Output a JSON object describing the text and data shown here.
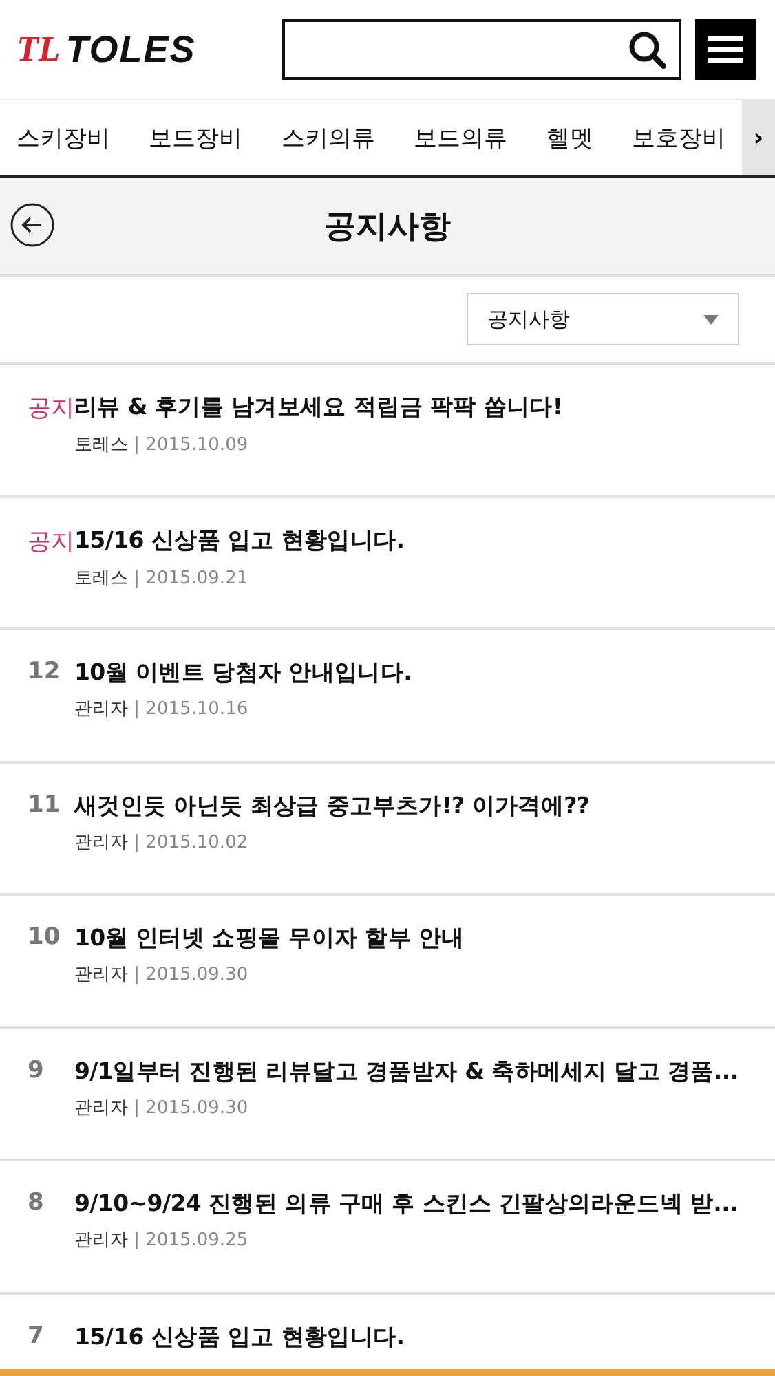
{
  "header": {
    "logo_mark": "TL",
    "logo_text": "TOLES"
  },
  "meta_separator": "|",
  "nav": {
    "items": [
      "스키장비",
      "보드장비",
      "스키의류",
      "보드의류",
      "헬멧",
      "보호장비"
    ],
    "more": "›"
  },
  "page_title": "공지사항",
  "filter": {
    "value": "공지사항"
  },
  "posts": [
    {
      "kind": "notice",
      "badge": "공지",
      "title": "리뷰 & 후기를 남겨보세요 적립금 팍팍 쏩니다!",
      "author": "토레스",
      "date": "2015.10.09"
    },
    {
      "kind": "notice",
      "badge": "공지",
      "title": "15/16 신상품 입고 현황입니다.",
      "author": "토레스",
      "date": "2015.09.21"
    },
    {
      "kind": "numbered",
      "badge": "12",
      "title": "10월 이벤트 당첨자 안내입니다.",
      "author": "관리자",
      "date": "2015.10.16"
    },
    {
      "kind": "numbered",
      "badge": "11",
      "title": "새것인듯 아닌듯 최상급 중고부츠가!? 이가격에??",
      "author": "관리자",
      "date": "2015.10.02"
    },
    {
      "kind": "numbered",
      "badge": "10",
      "title": "10월 인터넷 쇼핑몰 무이자 할부 안내",
      "author": "관리자",
      "date": "2015.09.30"
    },
    {
      "kind": "numbered",
      "badge": "9",
      "title": "9/1일부터 진행된 리뷰달고 경품받자 & 축하메세지 달고 경품...",
      "author": "관리자",
      "date": "2015.09.30"
    },
    {
      "kind": "numbered",
      "badge": "8",
      "title": "9/10~9/24 진행된 의류 구매 후 스킨스 긴팔상의라운드넥 받...",
      "author": "관리자",
      "date": "2015.09.25"
    },
    {
      "kind": "numbered",
      "badge": "7",
      "title": "15/16 신상품 입고 현황입니다."
    }
  ]
}
